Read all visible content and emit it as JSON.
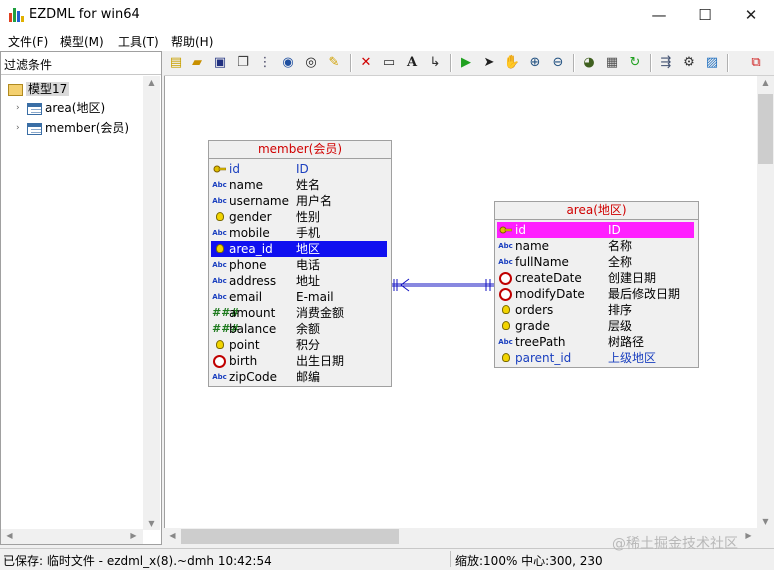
{
  "window": {
    "title": "EZDML for win64",
    "minimize": "—",
    "maximize": "☐",
    "close": "✕"
  },
  "menu": [
    "文件(F)",
    "模型(M)",
    "工具(T)",
    "帮助(H)"
  ],
  "left_panel": {
    "filter_label": "过滤条件",
    "model_label": "模型17",
    "tables": [
      "area(地区)",
      "member(会员)"
    ]
  },
  "entities": {
    "member": {
      "title": "member(会员)",
      "fields": [
        {
          "name": "id",
          "cn": "ID",
          "icon": "key-icon",
          "style": "pk"
        },
        {
          "name": "name",
          "cn": "姓名",
          "icon": "abc-icon"
        },
        {
          "name": "username",
          "cn": "用户名",
          "icon": "abc-icon"
        },
        {
          "name": "gender",
          "cn": "性别",
          "icon": "bulb-icon"
        },
        {
          "name": "mobile",
          "cn": "手机",
          "icon": "abc-icon"
        },
        {
          "name": "area_id",
          "cn": "地区",
          "icon": "bulb-icon",
          "style": "selected"
        },
        {
          "name": "phone",
          "cn": "电话",
          "icon": "abc-icon"
        },
        {
          "name": "address",
          "cn": "地址",
          "icon": "abc-icon"
        },
        {
          "name": "email",
          "cn": "E-mail",
          "icon": "abc-icon"
        },
        {
          "name": "amount",
          "cn": "消费金额",
          "icon": "hash-icon"
        },
        {
          "name": "balance",
          "cn": "余额",
          "icon": "hash-icon"
        },
        {
          "name": "point",
          "cn": "积分",
          "icon": "bulb-icon"
        },
        {
          "name": "birth",
          "cn": "出生日期",
          "icon": "clock-icon"
        },
        {
          "name": "zipCode",
          "cn": "邮编",
          "icon": "abc-icon"
        }
      ]
    },
    "area": {
      "title": "area(地区)",
      "fields": [
        {
          "name": "id",
          "cn": "ID",
          "icon": "key-icon",
          "style": "pk-highlight"
        },
        {
          "name": "name",
          "cn": "名称",
          "icon": "abc-icon"
        },
        {
          "name": "fullName",
          "cn": "全称",
          "icon": "abc-icon"
        },
        {
          "name": "createDate",
          "cn": "创建日期",
          "icon": "clock-icon"
        },
        {
          "name": "modifyDate",
          "cn": "最后修改日期",
          "icon": "clock-icon"
        },
        {
          "name": "orders",
          "cn": "排序",
          "icon": "bulb-icon"
        },
        {
          "name": "grade",
          "cn": "层级",
          "icon": "bulb-icon"
        },
        {
          "name": "treePath",
          "cn": "树路径",
          "icon": "abc-icon"
        },
        {
          "name": "parent_id",
          "cn": "上级地区",
          "icon": "bulb-icon",
          "style": "fk"
        }
      ]
    }
  },
  "status": {
    "left": "已保存: 临时文件 - ezdml_x(8).~dmh 10:42:54",
    "right": "缩放:100% 中心:300, 230"
  },
  "watermark": "@稀土掘金技术社区",
  "colors": {
    "selection": "#1010f0",
    "pk_highlight": "#ff20ff",
    "entity_title": "#d00000"
  }
}
